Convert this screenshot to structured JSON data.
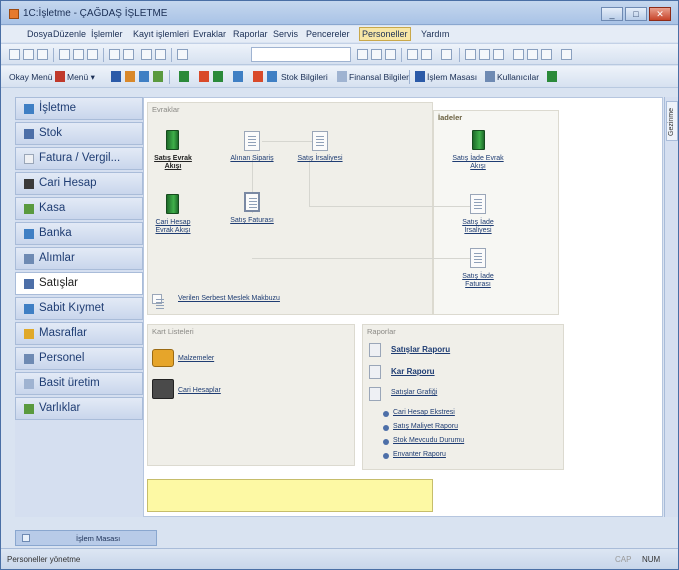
{
  "window": {
    "title": "1C:İşletme - ÇAĞDAŞ İŞLETME",
    "controls": [
      "_",
      "□",
      "✕"
    ]
  },
  "menu": [
    "Dosya",
    "Düzenle",
    "İşlemler",
    "Kayıt işlemleri",
    "Evraklar",
    "Raporlar",
    "Servis",
    "Pencereler",
    "Personeller",
    "Yardım"
  ],
  "toolbar2": {
    "items": [
      "Okay Menü",
      "Menü ▾"
    ],
    "stock_button": "Stok Bilgileri",
    "finance_button": "Finansal Bilgiler",
    "desk_button": "İşlem Masası",
    "users_button": "Kullanıcılar"
  },
  "sidebar": {
    "items": [
      {
        "label": "İşletme",
        "icon": "building-icon"
      },
      {
        "label": "Stok",
        "icon": "stock-icon"
      },
      {
        "label": "Fatura / Vergil...",
        "icon": "invoice-icon"
      },
      {
        "label": "Cari Hesap",
        "icon": "account-icon"
      },
      {
        "label": "Kasa",
        "icon": "cashbox-icon"
      },
      {
        "label": "Banka",
        "icon": "bank-icon"
      },
      {
        "label": "Alımlar",
        "icon": "purchase-icon"
      },
      {
        "label": "Satışlar",
        "icon": "sales-icon"
      },
      {
        "label": "Sabit Kıymet",
        "icon": "asset-icon"
      },
      {
        "label": "Masraflar",
        "icon": "expense-icon"
      },
      {
        "label": "Personel",
        "icon": "personnel-icon"
      },
      {
        "label": "Basit üretim",
        "icon": "production-icon"
      },
      {
        "label": "Varlıklar",
        "icon": "assets-icon"
      }
    ],
    "active_index": 7
  },
  "right_strip": {
    "tab_label": "Gezinme"
  },
  "evraklar": {
    "title": "Evraklar",
    "items": {
      "satis_evrak_akisi": "Satış Evrak Akışı",
      "alinan_siparis": "Alınan Sipariş",
      "satis_irsaliyesi": "Satış İrsaliyesi",
      "cari_hesap_evrak_akisi": "Cari Hesap Evrak Akışı",
      "satis_faturasi": "Satış Faturası",
      "verilen_serbest_meslek": "Verilen Serbest Meslek Makbuzu"
    }
  },
  "iadeler": {
    "title": "İadeler",
    "items": {
      "satis_iade_evrak_akisi": "Satış İade Evrak Akışı",
      "satis_iade_irsaliyesi": "Satış İade İrsaliyesi",
      "satis_iade_faturasi": "Satış İade Faturası"
    }
  },
  "kart_listeleri": {
    "title": "Kart Listeleri",
    "items": [
      "Malzemeler",
      "Cari Hesaplar"
    ]
  },
  "raporlar": {
    "title": "Raporlar",
    "main": [
      "Satışlar Raporu",
      "Kar Raporu",
      "Satışlar Grafiği"
    ],
    "sub": [
      "Cari Hesap Ekstresi",
      "Satış Maliyet Raporu",
      "Stok Mevcudu Durumu",
      "Envanter Raporu"
    ]
  },
  "bottom_tab": {
    "label": "İşlem Masası"
  },
  "statusbar": {
    "left": "Personeller yönetme",
    "cap": "CAP",
    "num": "NUM"
  }
}
